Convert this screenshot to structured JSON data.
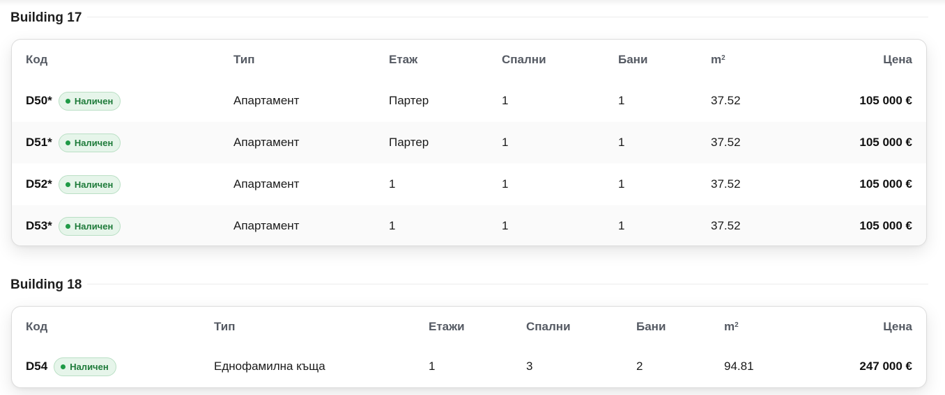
{
  "buildings": [
    {
      "title": "Building 17",
      "headers": {
        "code": "Код",
        "type": "Тип",
        "floor": "Етаж",
        "bedrooms": "Спални",
        "bathrooms": "Бани",
        "area": "m",
        "area_sup": "2",
        "price": "Цена"
      },
      "rows": [
        {
          "code": "D50*",
          "status": "Наличен",
          "type": "Апартамент",
          "floor": "Партер",
          "bedrooms": "1",
          "bathrooms": "1",
          "area": "37.52",
          "price": "105 000 €"
        },
        {
          "code": "D51*",
          "status": "Наличен",
          "type": "Апартамент",
          "floor": "Партер",
          "bedrooms": "1",
          "bathrooms": "1",
          "area": "37.52",
          "price": "105 000 €"
        },
        {
          "code": "D52*",
          "status": "Наличен",
          "type": "Апартамент",
          "floor": "1",
          "bedrooms": "1",
          "bathrooms": "1",
          "area": "37.52",
          "price": "105 000 €"
        },
        {
          "code": "D53*",
          "status": "Наличен",
          "type": "Апартамент",
          "floor": "1",
          "bedrooms": "1",
          "bathrooms": "1",
          "area": "37.52",
          "price": "105 000 €"
        }
      ]
    },
    {
      "title": "Building 18",
      "headers": {
        "code": "Код",
        "type": "Тип",
        "floor": "Етажи",
        "bedrooms": "Спални",
        "bathrooms": "Бани",
        "area": "m",
        "area_sup": "2",
        "price": "Цена"
      },
      "rows": [
        {
          "code": "D54",
          "status": "Наличен",
          "type": "Еднофамилна къща",
          "floor": "1",
          "bedrooms": "3",
          "bathrooms": "2",
          "area": "94.81",
          "price": "247 000 €"
        }
      ]
    }
  ],
  "colors": {
    "badge_bg": "#e6f5ea",
    "badge_text": "#1e7b3a",
    "badge_dot": "#1f9a46"
  }
}
